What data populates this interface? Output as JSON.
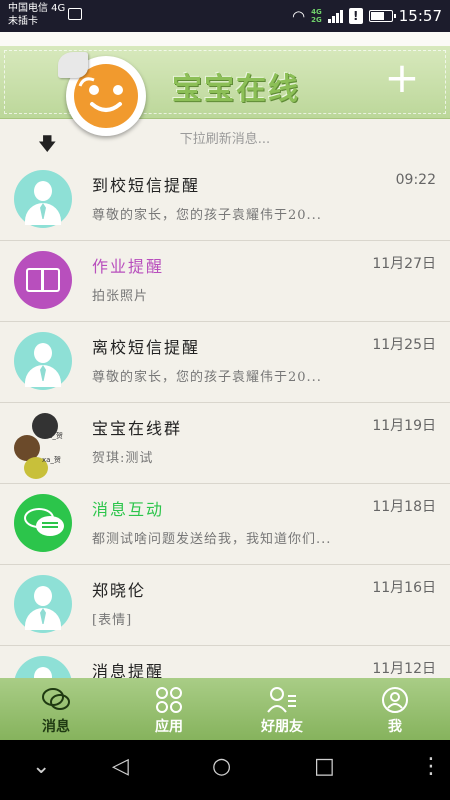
{
  "status": {
    "carrier": "中国电信 4G",
    "sim": "未插卡",
    "net_top": "4G",
    "net_bottom": "2G",
    "time": "15:57"
  },
  "header": {
    "title": "宝宝在线",
    "add_label": "+"
  },
  "pull_hint": "下拉刷新消息...",
  "conversations": [
    {
      "name": "到校短信提醒",
      "time": "09:22",
      "preview": "尊敬的家长，您的孩子袁耀伟于20...",
      "avatar_color": "#8ee0d6"
    },
    {
      "name": "作业提醒",
      "time": "11月27日",
      "preview": "拍张照片",
      "avatar_color": "#b84fbd",
      "name_color": "#b84fbd"
    },
    {
      "name": "离校短信提醒",
      "time": "11月25日",
      "preview": "尊敬的家长，您的孩子袁耀伟于20...",
      "avatar_color": "#8ee0d6"
    },
    {
      "name": "宝宝在线群",
      "time": "11月19日",
      "preview": "贺琪:测试",
      "group_labels": [
        "xa_贺",
        "xa_贺"
      ]
    },
    {
      "name": "消息互动",
      "time": "11月18日",
      "preview": "都测试啥问题发送给我，我知道你们...",
      "avatar_color": "#2cc54b",
      "name_color": "#2cc54b"
    },
    {
      "name": "郑晓伦",
      "time": "11月16日",
      "preview": "[表情]",
      "avatar_color": "#8ee0d6"
    },
    {
      "name": "消息提醒",
      "time": "11月12日",
      "preview": "",
      "avatar_color": "#8ee0d6"
    }
  ],
  "tabs": [
    {
      "label": "消息",
      "icon": "chat-icon",
      "active": true
    },
    {
      "label": "应用",
      "icon": "apps-icon"
    },
    {
      "label": "好朋友",
      "icon": "friends-icon"
    },
    {
      "label": "我",
      "icon": "profile-icon"
    }
  ],
  "nav": {
    "down": "⌄",
    "back": "◁",
    "home": "○",
    "recent": "□",
    "more": "⋮"
  }
}
